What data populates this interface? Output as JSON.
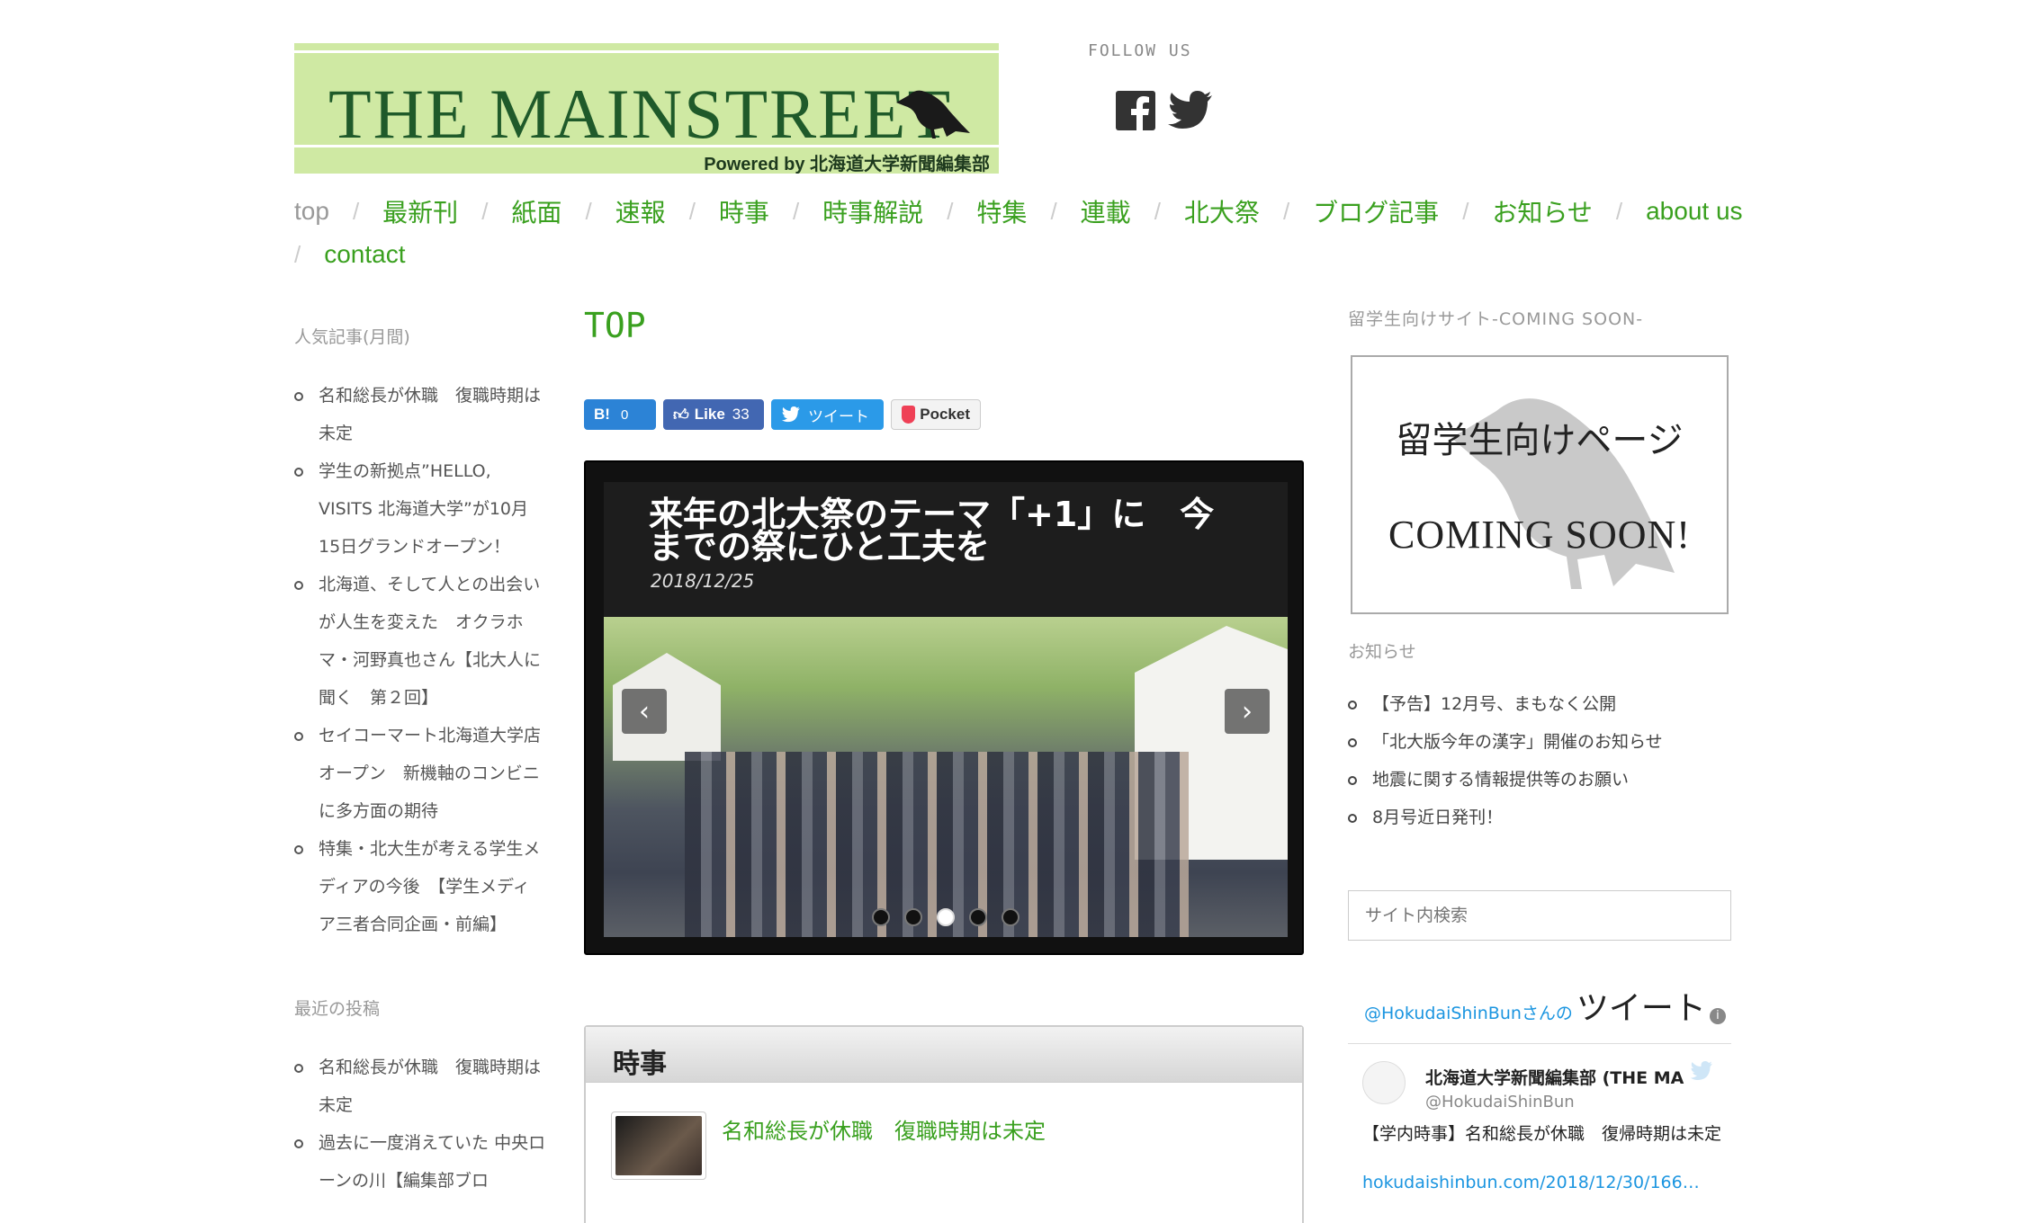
{
  "header": {
    "logo_title": "THE MAINSTREET",
    "logo_powered": "Powered by 北海道大学新聞編集部",
    "follow_label": "FOLLOW US"
  },
  "nav": {
    "row1": [
      "top",
      "最新刊",
      "紙面",
      "速報",
      "時事",
      "時事解説",
      "特集",
      "連載",
      "北大祭",
      "ブログ記事",
      "お知らせ",
      "about us"
    ],
    "row2": [
      "contact"
    ],
    "separator": "/"
  },
  "left_sidebar": {
    "popular_title": "人気記事(月間)",
    "popular": [
      "名和総長が休職　復職時期は未定",
      "学生の新拠点”HELLO, VISITS 北海道大学”が10月15日グランドオープン！",
      "北海道、そして人との出会いが人生を変えた　オクラホマ・河野真也さん【北大人に聞く　第２回】",
      "セイコーマート北海道大学店　オープン　新機軸のコンビニに多方面の期待",
      "特集・北大生が考える学生メディアの今後　【学生メディア三者合同企画・前編】"
    ],
    "recent_title": "最近の投稿",
    "recent": [
      "名和総長が休職　復職時期は未定",
      "過去に一度消えていた 中央ローンの川【編集部ブロ"
    ]
  },
  "main": {
    "title": "TOP",
    "share": {
      "hatena_mark": "B!",
      "hatena_count": "0",
      "like_label": "Like",
      "like_count": "33",
      "tweet_label": "ツイート",
      "pocket_label": "Pocket"
    },
    "slider": {
      "title": "来年の北大祭のテーマ「+1」に　今までの祭にひと工夫を",
      "date": "2018/12/25",
      "prev_glyph": "‹",
      "next_glyph": "›",
      "active_index": 2,
      "count": 5
    },
    "news": {
      "heading": "時事",
      "item": "名和総長が休職　復職時期は未定"
    }
  },
  "right_sidebar": {
    "intl_title": "留学生向けサイト-COMING SOON-",
    "banner_line1": "留学生向けページ",
    "banner_line2": "COMING SOON!",
    "notice_title": "お知らせ",
    "notices": [
      "【予告】12月号、まもなく公開",
      "「北大版今年の漢字」開催のお知らせ",
      "地震に関する情報提供等のお願い",
      "8月号近日発刊！"
    ],
    "search_placeholder": "サイト内検索",
    "twitter": {
      "handle_link": "@HokudaiShinBun",
      "san": "さんの",
      "tweets_label": "ツイート",
      "info": "i",
      "name": "北海道大学新聞編集部 (THE MA",
      "handle": "@HokudaiShinBun",
      "text": "【学内時事】名和総長が休職　復帰時期は未定",
      "url": "hokudaishinbun.com/2018/12/30/166…"
    }
  },
  "colors": {
    "accent_green": "#3aa01f",
    "logo_bg": "#cfe9a3",
    "twitter_blue": "#1b95e0"
  },
  "icons": [
    "facebook-icon",
    "twitter-icon",
    "crow-logo-icon",
    "pocket-icon",
    "info-icon",
    "twitter-bird-icon"
  ]
}
